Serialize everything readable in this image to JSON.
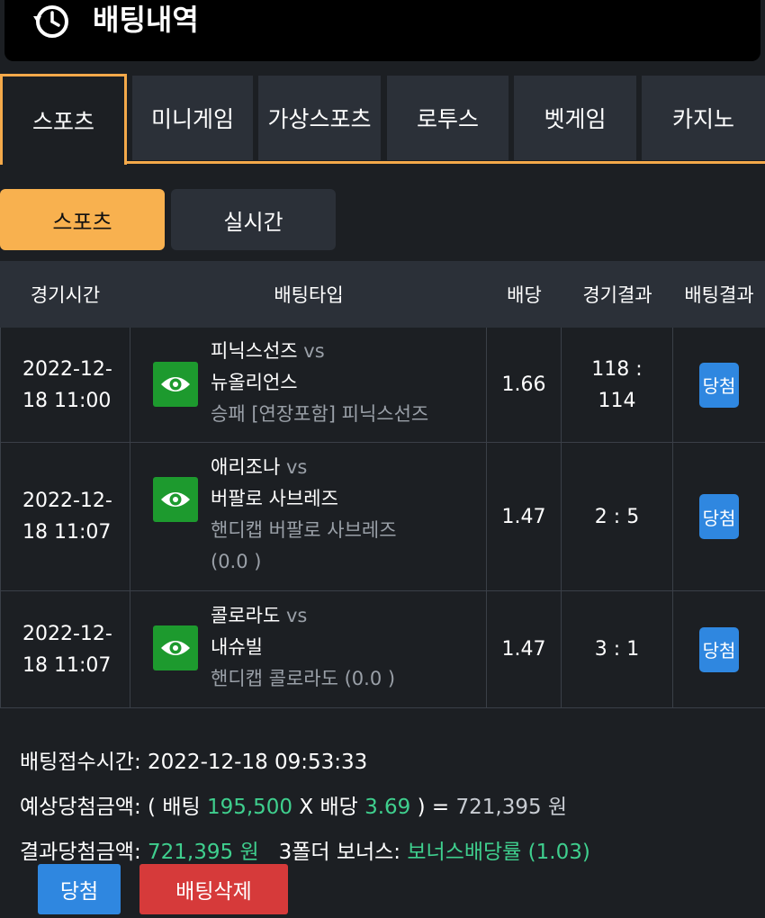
{
  "header": {
    "title": "배팅내역",
    "icon": "history-clock-icon"
  },
  "tabs": [
    "스포츠",
    "미니게임",
    "가상스포츠",
    "로투스",
    "벳게임",
    "카지노"
  ],
  "subtabs": [
    "스포츠",
    "실시간"
  ],
  "table": {
    "headers": [
      "경기시간",
      "배팅타입",
      "배당",
      "경기결과",
      "배팅결과"
    ],
    "rows": [
      {
        "date": "2022-12-",
        "time": "18 11:00",
        "home": "피닉스선즈",
        "vs": "vs",
        "away": "뉴올리언스",
        "pick": "승패 [연장포함] 피닉스선즈",
        "pick2": "",
        "odds": "1.66",
        "score1": "118 :",
        "score2": "114",
        "status": "당첨"
      },
      {
        "date": "2022-12-",
        "time": "18 11:07",
        "home": "애리조나",
        "vs": "vs",
        "away": "버팔로 사브레즈",
        "pick": "핸디캡 버팔로 사브레즈",
        "pick2": "(0.0 )",
        "odds": "1.47",
        "score1": "2 : 5",
        "score2": "",
        "status": "당첨"
      },
      {
        "date": "2022-12-",
        "time": "18 11:07",
        "home": "콜로라도",
        "vs": "vs",
        "away": "내슈빌",
        "pick": "핸디캡 콜로라도 (0.0 )",
        "pick2": "",
        "odds": "1.47",
        "score1": "3 : 1",
        "score2": "",
        "status": "당첨"
      }
    ]
  },
  "summary": {
    "received_label": "배팅접수시간:",
    "received_value": "2022-12-18 09:53:33",
    "expected_label": "예상당첨금액:",
    "expected_open": "( 배팅",
    "bet_amount": "195,500",
    "x_label": "X 배당",
    "total_odds": "3.69",
    "eq": ") =",
    "expected_value": "721,395 원",
    "result_label": "결과당첨금액:",
    "result_value": "721,395 원",
    "bonus_label": "3폴더 보너스:",
    "bonus_value": "보너스배당률 (1.03)"
  },
  "buttons": {
    "win": "당첨",
    "delete": "배팅삭제"
  },
  "colors": {
    "accent": "#f4a94a",
    "win_badge": "#2f87e0",
    "delete": "#d63a3a",
    "eye": "#1d9a2e",
    "highlight": "#3fcf8e"
  }
}
